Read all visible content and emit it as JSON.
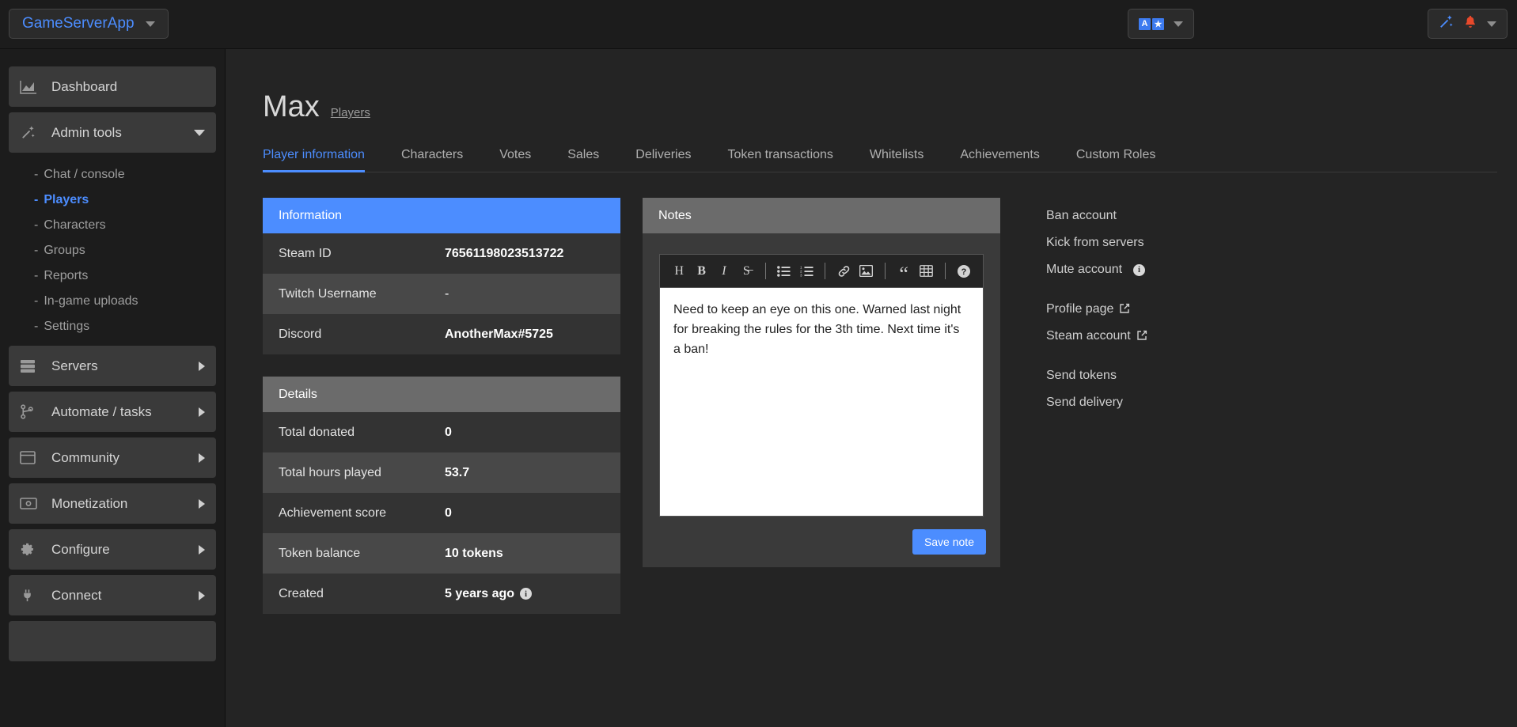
{
  "topbar": {
    "brand": "GameServerApp",
    "brand_caret_icon": "chevron-down-icon",
    "language_icon": "language-flag-icon",
    "language_letters": [
      "A",
      "★"
    ],
    "language_caret_icon": "chevron-down-icon",
    "wand_icon": "magic-wand-icon",
    "bell_icon": "bell-icon",
    "notif_caret_icon": "chevron-down-icon"
  },
  "sidebar": {
    "items": [
      {
        "label": "Dashboard",
        "icon": "chart-area-icon",
        "arrow": "none"
      },
      {
        "label": "Admin tools",
        "icon": "magic-wand-icon",
        "arrow": "down"
      },
      {
        "label": "Servers",
        "icon": "server-rack-icon",
        "arrow": "right"
      },
      {
        "label": "Automate / tasks",
        "icon": "code-branch-icon",
        "arrow": "right"
      },
      {
        "label": "Community",
        "icon": "window-icon",
        "arrow": "right"
      },
      {
        "label": "Monetization",
        "icon": "money-bill-icon",
        "arrow": "right"
      },
      {
        "label": "Configure",
        "icon": "gear-icon",
        "arrow": "right"
      },
      {
        "label": "Connect",
        "icon": "plug-icon",
        "arrow": "right"
      }
    ],
    "admin_tools_sub": [
      {
        "label": "Chat / console",
        "active": false
      },
      {
        "label": "Players",
        "active": true
      },
      {
        "label": "Characters",
        "active": false
      },
      {
        "label": "Groups",
        "active": false
      },
      {
        "label": "Reports",
        "active": false
      },
      {
        "label": "In-game uploads",
        "active": false
      },
      {
        "label": "Settings",
        "active": false
      }
    ],
    "dash_prefix": "-"
  },
  "page": {
    "title": "Max",
    "breadcrumb": "Players",
    "tabs": [
      {
        "label": "Player information",
        "active": true
      },
      {
        "label": "Characters",
        "active": false
      },
      {
        "label": "Votes",
        "active": false
      },
      {
        "label": "Sales",
        "active": false
      },
      {
        "label": "Deliveries",
        "active": false
      },
      {
        "label": "Token transactions",
        "active": false
      },
      {
        "label": "Whitelists",
        "active": false
      },
      {
        "label": "Achievements",
        "active": false
      },
      {
        "label": "Custom Roles",
        "active": false
      }
    ]
  },
  "information": {
    "heading": "Information",
    "rows": [
      {
        "key": "Steam ID",
        "value": "76561198023513722",
        "bold": true
      },
      {
        "key": "Twitch Username",
        "value": "-",
        "bold": false
      },
      {
        "key": "Discord",
        "value": "AnotherMax#5725",
        "bold": true
      }
    ]
  },
  "details": {
    "heading": "Details",
    "rows": [
      {
        "key": "Total donated",
        "value": "0",
        "info": false
      },
      {
        "key": "Total hours played",
        "value": "53.7",
        "info": false
      },
      {
        "key": "Achievement score",
        "value": "0",
        "info": false
      },
      {
        "key": "Token balance",
        "value": "10 tokens",
        "info": false
      },
      {
        "key": "Created",
        "value": "5 years ago",
        "info": true
      }
    ],
    "info_glyph": "i"
  },
  "notes": {
    "heading": "Notes",
    "toolbar": [
      {
        "icon": "heading-icon",
        "glyph": "H",
        "serif": true
      },
      {
        "icon": "bold-icon",
        "glyph": "B",
        "serif": true
      },
      {
        "icon": "italic-icon",
        "glyph": "I",
        "serif": true
      },
      {
        "icon": "strikethrough-icon",
        "glyph": "S̶",
        "serif": true
      },
      {
        "icon": "separator",
        "glyph": "",
        "serif": false
      },
      {
        "icon": "bullet-list-icon",
        "glyph": "☰",
        "serif": false
      },
      {
        "icon": "numbered-list-icon",
        "glyph": "≡",
        "serif": false
      },
      {
        "icon": "separator",
        "glyph": "",
        "serif": false
      },
      {
        "icon": "link-icon",
        "glyph": "🔗",
        "serif": false
      },
      {
        "icon": "image-icon",
        "glyph": "Ὓc",
        "serif": false
      },
      {
        "icon": "separator",
        "glyph": "",
        "serif": false
      },
      {
        "icon": "quote-icon",
        "glyph": "“",
        "serif": true
      },
      {
        "icon": "table-icon",
        "glyph": "▦",
        "serif": false
      },
      {
        "icon": "separator",
        "glyph": "",
        "serif": false
      },
      {
        "icon": "help-icon",
        "glyph": "?",
        "serif": false
      }
    ],
    "body_text": "Need to keep an eye on this one. Warned last night for breaking the rules for the 3th time. Next time it's a ban!",
    "save_label": "Save note"
  },
  "actions": {
    "groups": [
      [
        {
          "label": "Ban account",
          "external": false,
          "info": false
        },
        {
          "label": "Kick from servers",
          "external": false,
          "info": false
        },
        {
          "label": "Mute account",
          "external": false,
          "info": true
        }
      ],
      [
        {
          "label": "Profile page",
          "external": true,
          "info": false
        },
        {
          "label": "Steam account",
          "external": true,
          "info": false
        }
      ],
      [
        {
          "label": "Send tokens",
          "external": false,
          "info": false
        },
        {
          "label": "Send delivery",
          "external": false,
          "info": false
        }
      ]
    ],
    "external_glyph": "↗",
    "info_glyph": "i"
  },
  "colors": {
    "accent": "#4c8dff",
    "panel_head_grey": "#6b6b6b",
    "row_odd": "#333333",
    "row_even": "#484848",
    "bell": "#e8492b"
  }
}
